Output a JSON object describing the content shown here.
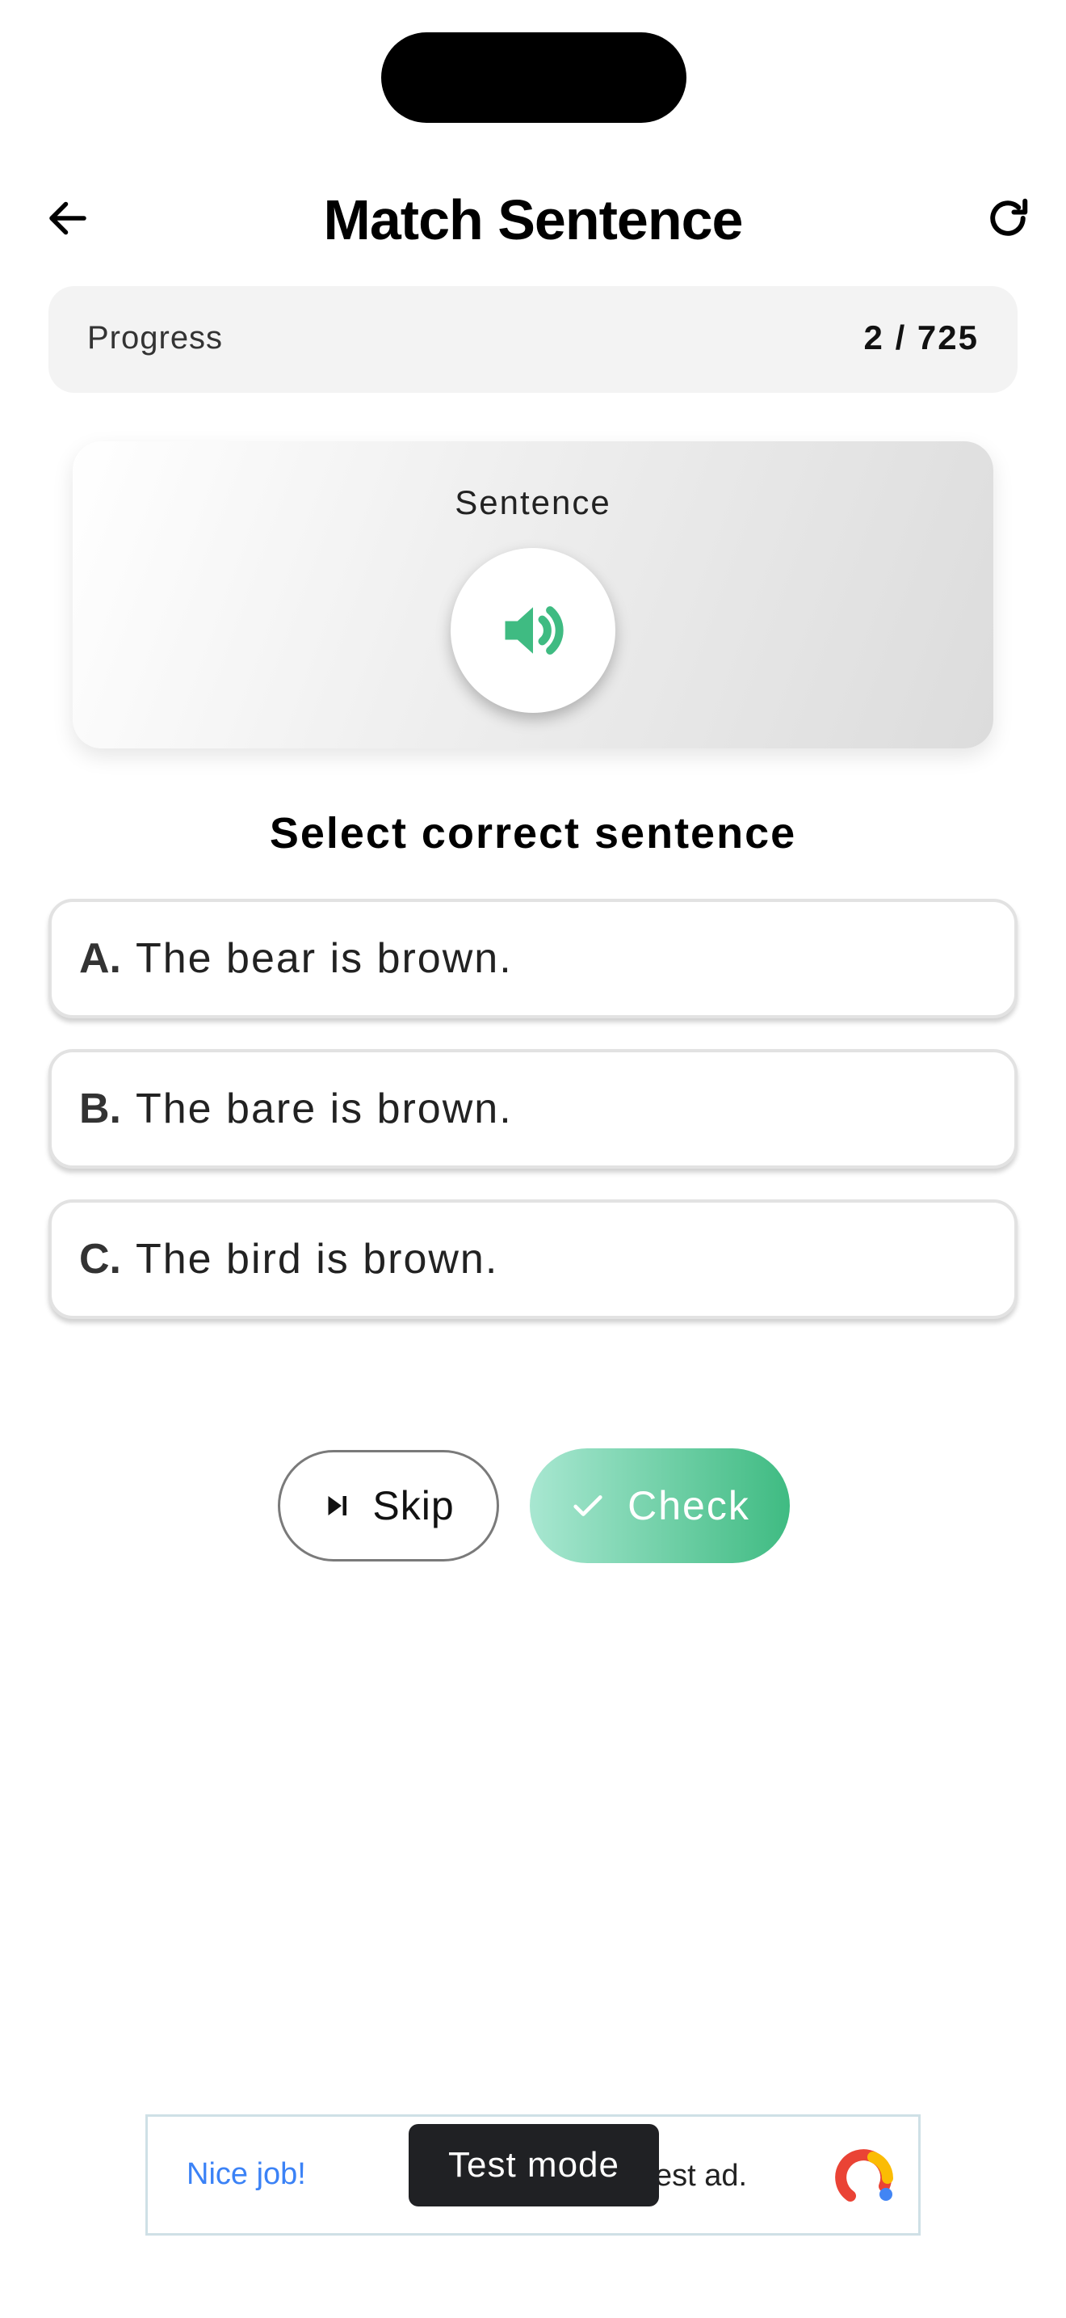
{
  "header": {
    "title": "Match Sentence",
    "back_icon": "arrow-left-icon",
    "refresh_icon": "refresh-icon"
  },
  "progress": {
    "label": "Progress",
    "value": "2 / 725"
  },
  "sentence_card": {
    "label": "Sentence",
    "speaker_icon": "speaker-icon"
  },
  "question": "Select correct sentence",
  "options": [
    {
      "letter": "A.",
      "text": "The bear is brown."
    },
    {
      "letter": "B.",
      "text": "The bare is brown."
    },
    {
      "letter": "C.",
      "text": "The bird is brown."
    }
  ],
  "actions": {
    "skip_label": "Skip",
    "check_label": "Check"
  },
  "ad": {
    "headline": "Nice job!",
    "text": "est ad.",
    "test_mode": "Test mode"
  },
  "colors": {
    "accent": "#3fbb82",
    "accent_light": "#a8e7d1",
    "ad_link": "#3b82f6",
    "progress_bg": "#f3f3f3"
  }
}
